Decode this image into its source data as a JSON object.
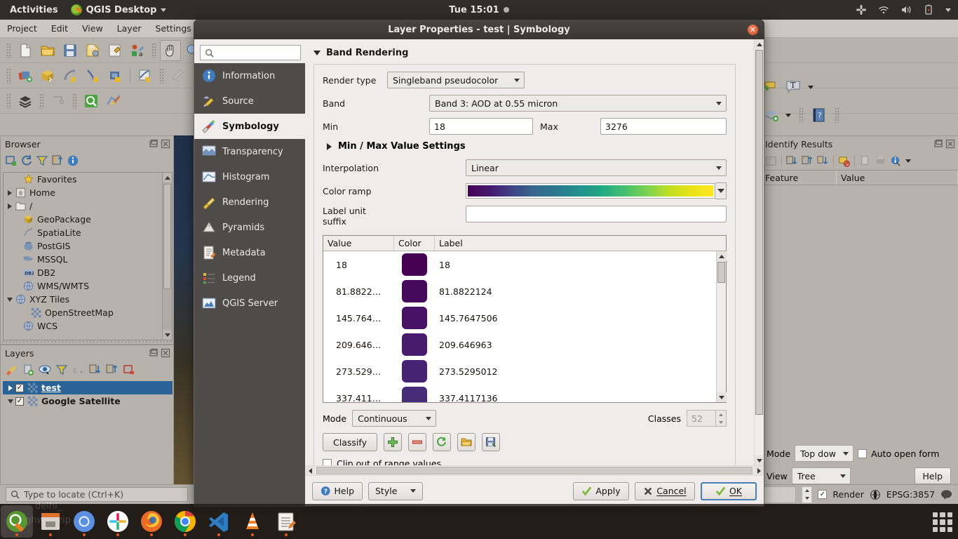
{
  "gnome": {
    "activities": "Activities",
    "app_name": "QGIS Desktop",
    "clock": "Tue 15:01",
    "tray": [
      "slack-icon",
      "wifi-icon",
      "volume-icon",
      "battery-icon",
      "chevron-down-icon"
    ]
  },
  "qgis": {
    "menu": [
      "Project",
      "Edit",
      "View",
      "Layer",
      "Settings"
    ],
    "toolbar_row1": [
      "new-project-icon",
      "open-project-icon",
      "save-project-icon",
      "save-as-icon",
      "project-properties-icon",
      "style-manager-icon",
      "pan-map-icon",
      "zoom-full-icon"
    ],
    "toolbar_row2": [
      "new-layer-icon",
      "new-geopackage-icon",
      "new-spatialite-icon",
      "new-virtual-layer-icon",
      "new-memory-layer-icon",
      "new-mesh-layer-icon",
      "edit-pencil-icon"
    ],
    "toolbar_row3": [
      "open-data-source-icon",
      "measure-icon",
      "identify-features-icon",
      "map-tips-icon"
    ],
    "toolbar_right": [
      "annotation-icon",
      "text-annotation-icon",
      "add-layer-icon",
      "help-icon"
    ]
  },
  "browser": {
    "title": "Browser",
    "toolbar": [
      "add-selected-layers-icon",
      "refresh-icon",
      "filter-icon",
      "collapse-all-icon",
      "properties-icon"
    ],
    "items": [
      {
        "label": "Favorites",
        "icon": "star-icon",
        "expander": "none",
        "indent": 1
      },
      {
        "label": "Home",
        "icon": "home-icon",
        "expander": "collapsed",
        "indent": 0
      },
      {
        "label": "/",
        "icon": "folder-icon",
        "expander": "collapsed",
        "indent": 0
      },
      {
        "label": "GeoPackage",
        "icon": "geopackage-icon",
        "expander": "none",
        "indent": 1
      },
      {
        "label": "SpatiaLite",
        "icon": "spatialite-icon",
        "expander": "none",
        "indent": 1
      },
      {
        "label": "PostGIS",
        "icon": "postgis-icon",
        "expander": "none",
        "indent": 1
      },
      {
        "label": "MSSQL",
        "icon": "mssql-icon",
        "expander": "none",
        "indent": 1
      },
      {
        "label": "DB2",
        "icon": "db2-icon",
        "expander": "none",
        "indent": 1
      },
      {
        "label": "WMS/WMTS",
        "icon": "globe-icon",
        "expander": "none",
        "indent": 1
      },
      {
        "label": "XYZ Tiles",
        "icon": "globe-icon",
        "expander": "expanded",
        "indent": 0
      },
      {
        "label": "OpenStreetMap",
        "icon": "raster-icon",
        "expander": "none",
        "indent": 2
      },
      {
        "label": "WCS",
        "icon": "globe-icon",
        "expander": "none",
        "indent": 1
      }
    ]
  },
  "layers": {
    "title": "Layers",
    "toolbar": [
      "open-layer-styling-icon",
      "add-group-icon",
      "manage-visibility-icon",
      "filter-legend-icon",
      "expression-filter-icon",
      "expand-all-icon",
      "collapse-all-icon",
      "remove-layer-icon"
    ],
    "items": [
      {
        "label": "test",
        "checked": true,
        "selected": true,
        "expander": "collapsed"
      },
      {
        "label": "Google Satellite",
        "checked": true,
        "selected": false,
        "expander": "expanded"
      }
    ]
  },
  "identify": {
    "title": "Identify Results",
    "toolbar": [
      "expand-tree-icon",
      "expand-new-icon",
      "collapse-all-icon",
      "highlight-icon",
      "clear-results-icon",
      "copy-icon",
      "print-icon",
      "identify-settings-icon",
      "chevron-down-icon"
    ],
    "columns": [
      "Feature",
      "Value"
    ],
    "mode_label": "Mode",
    "mode_value": "Top dow",
    "auto_open_label": "Auto open form",
    "view_label": "View",
    "view_value": "Tree",
    "help_label": "Help"
  },
  "statusbar": {
    "locator_placeholder": "Type to locate (Ctrl+K)",
    "rotation_value": "",
    "rotation_unit": "°",
    "render_label": "Render",
    "crs": "EPSG:3857",
    "messages_icon": "messages-icon"
  },
  "dialog": {
    "title": "Layer Properties - test | Symbology",
    "close_icon": "close-icon",
    "search_placeholder": "",
    "search_icon": "search-icon",
    "tabs": [
      {
        "label": "Information",
        "icon": "information-icon",
        "selected": false
      },
      {
        "label": "Source",
        "icon": "source-icon",
        "selected": false
      },
      {
        "label": "Symbology",
        "icon": "symbology-icon",
        "selected": true
      },
      {
        "label": "Transparency",
        "icon": "transparency-icon",
        "selected": false
      },
      {
        "label": "Histogram",
        "icon": "histogram-icon",
        "selected": false
      },
      {
        "label": "Rendering",
        "icon": "rendering-icon",
        "selected": false
      },
      {
        "label": "Pyramids",
        "icon": "pyramids-icon",
        "selected": false
      },
      {
        "label": "Metadata",
        "icon": "metadata-icon",
        "selected": false
      },
      {
        "label": "Legend",
        "icon": "legend-icon",
        "selected": false
      },
      {
        "label": "QGIS Server",
        "icon": "qgis-server-icon",
        "selected": false
      }
    ],
    "band_rendering": {
      "section_title": "Band Rendering",
      "render_type_label": "Render type",
      "render_type_value": "Singleband pseudocolor",
      "band_label": "Band",
      "band_value": "Band 3: AOD at 0.55 micron",
      "min_label": "Min",
      "min_value": "18",
      "max_label": "Max",
      "max_value": "3276",
      "minmax_settings_label": "Min / Max Value Settings",
      "interpolation_label": "Interpolation",
      "interpolation_value": "Linear",
      "color_ramp_label": "Color ramp",
      "color_ramp_name": "Viridis",
      "label_unit_suffix_label": "Label unit suffix",
      "label_unit_suffix_value": "",
      "table": {
        "columns": [
          "Value",
          "Color",
          "Label"
        ],
        "rows": [
          {
            "value": "18",
            "color": "#440154",
            "label": "18"
          },
          {
            "value": "81.8822…",
            "color": "#460a5d",
            "label": "81.8822124"
          },
          {
            "value": "145.764…",
            "color": "#471365",
            "label": "145.7647506"
          },
          {
            "value": "209.646…",
            "color": "#481b6d",
            "label": "209.646963"
          },
          {
            "value": "273.529…",
            "color": "#482374",
            "label": "273.5295012"
          },
          {
            "value": "337.411…",
            "color": "#472c7a",
            "label": "337.4117136"
          }
        ]
      },
      "mode_label": "Mode",
      "mode_value": "Continuous",
      "classes_label": "Classes",
      "classes_value": "52",
      "classify_label": "Classify",
      "action_icons": [
        "add-entry-icon",
        "delete-entry-icon",
        "flip-colors-icon",
        "load-color-map-icon",
        "save-color-map-icon"
      ],
      "clip_label": "Clip out of range values"
    },
    "buttons": {
      "help": "Help",
      "style": "Style",
      "apply": "Apply",
      "cancel": "Cancel",
      "ok": "OK"
    }
  },
  "dock": {
    "icons": [
      "qgis-icon",
      "files-icon",
      "chromium-icon",
      "slack-icon",
      "firefox-icon",
      "chrome-icon",
      "vscode-icon",
      "vlc-icon",
      "text-editor-icon"
    ],
    "show_apps": "show-applications-icon"
  },
  "desktop": {
    "file_label_1": "delhi_",
    "file_label_2": "ghwv...zip"
  }
}
